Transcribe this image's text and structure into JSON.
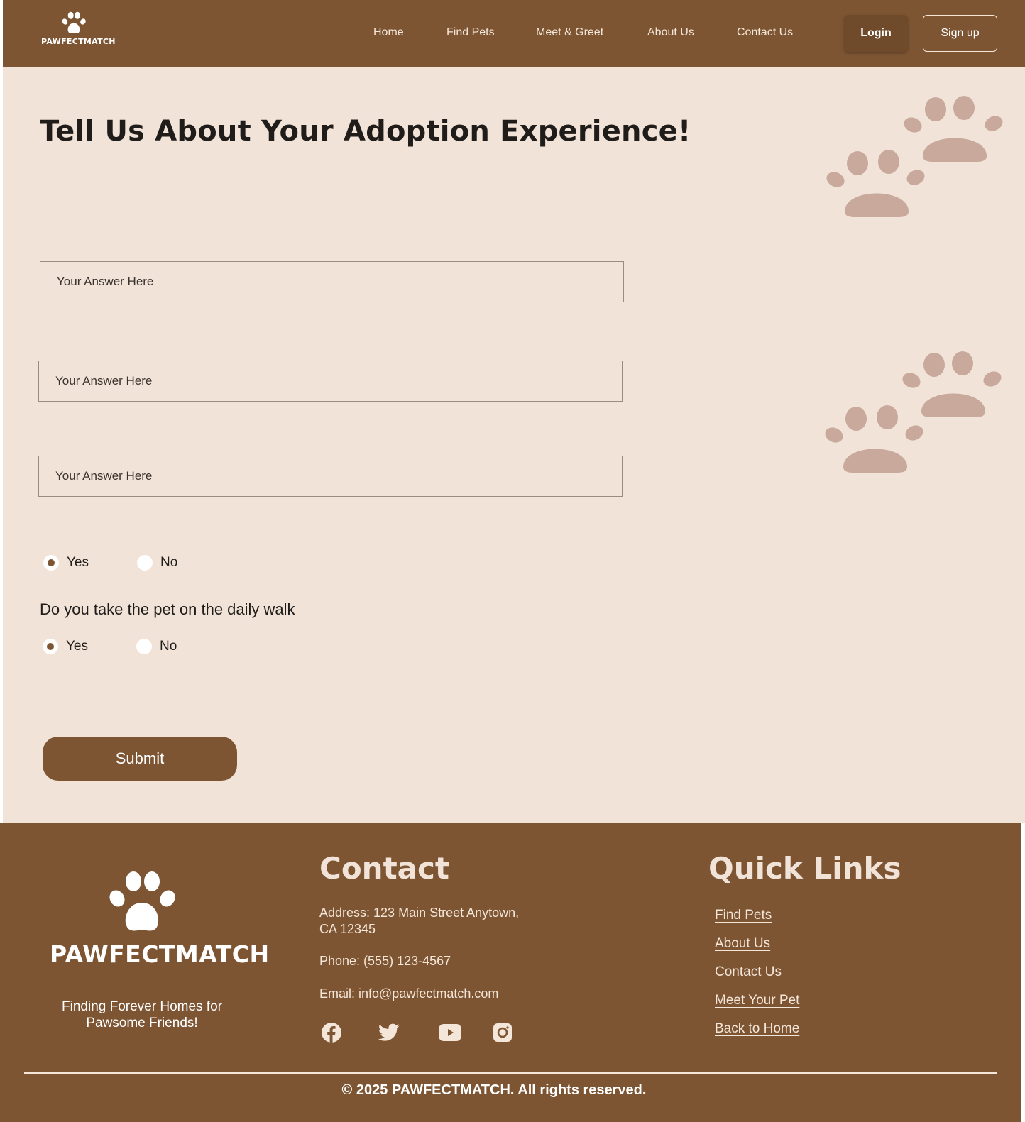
{
  "header": {
    "logo_text": "PAWFECTMATCH",
    "nav": [
      "Home",
      "Find Pets",
      "Meet & Greet",
      "About Us",
      "Contact Us"
    ],
    "login_label": "Login",
    "signup_label": "Sign up"
  },
  "main": {
    "title": "Tell Us About Your Adoption Experience!",
    "inputs": [
      {
        "placeholder": "Your Answer Here"
      },
      {
        "placeholder": "Your Answer Here"
      },
      {
        "placeholder": "Your Answer Here"
      }
    ],
    "radio_group_1": {
      "options": [
        "Yes",
        "No"
      ],
      "selected": "Yes"
    },
    "question_2": "Do you take the pet on the daily walk",
    "radio_group_2": {
      "options": [
        "Yes",
        "No"
      ],
      "selected": "Yes"
    },
    "submit_label": "Submit"
  },
  "footer": {
    "logo_text": "PAWFECTMATCH",
    "tagline": "Finding Forever Homes for Pawsome Friends!",
    "contact_heading": "Contact",
    "address": "Address: 123 Main Street Anytown, CA 12345",
    "phone": "Phone: (555) 123-4567",
    "email": "Email: info@pawfectmatch.com",
    "social_icons": [
      "facebook-icon",
      "twitter-icon",
      "youtube-icon",
      "instagram-icon"
    ],
    "quick_links_heading": "Quick Links",
    "quick_links": [
      "Find Pets",
      "About Us",
      "Contact Us",
      "Meet Your Pet",
      "Back to Home"
    ],
    "copyright": "© 2025 PAWFECTMATCH. All rights reserved."
  },
  "colors": {
    "brand_brown": "#7d5533",
    "background_cream": "#f1e3d8",
    "paw_decoration": "#c8a99c"
  }
}
